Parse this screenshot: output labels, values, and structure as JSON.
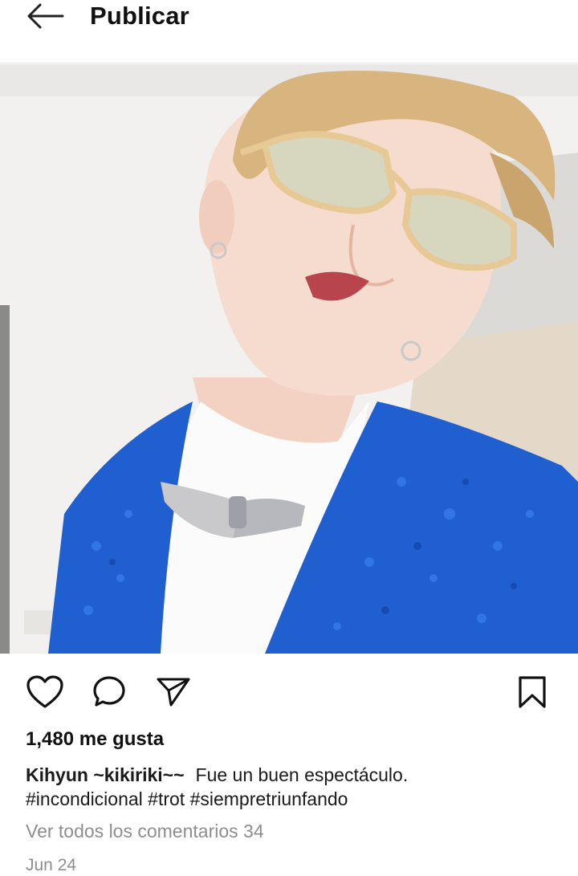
{
  "header": {
    "title": "Publicar",
    "back_icon": "arrow-left-icon"
  },
  "photo": {
    "description_icon": "post-photo",
    "colors": {
      "jacket": "#1f5fd0",
      "wall": "#f3f2f0",
      "floor": "#e2d6c5",
      "hair": "#d9b27a"
    }
  },
  "actions": {
    "like_icon": "heart-icon",
    "comment_icon": "comment-icon",
    "share_icon": "paper-plane-icon",
    "save_icon": "bookmark-icon"
  },
  "post": {
    "likes": "1,480 me gusta",
    "username": "Kihyun ~kikiriki~~",
    "caption_text": "Fue un buen espectáculo.",
    "hashtags": "#incondicional #trot #siempretriunfando",
    "comments_link": "Ver todos los comentarios 34",
    "date": "Jun 24"
  }
}
